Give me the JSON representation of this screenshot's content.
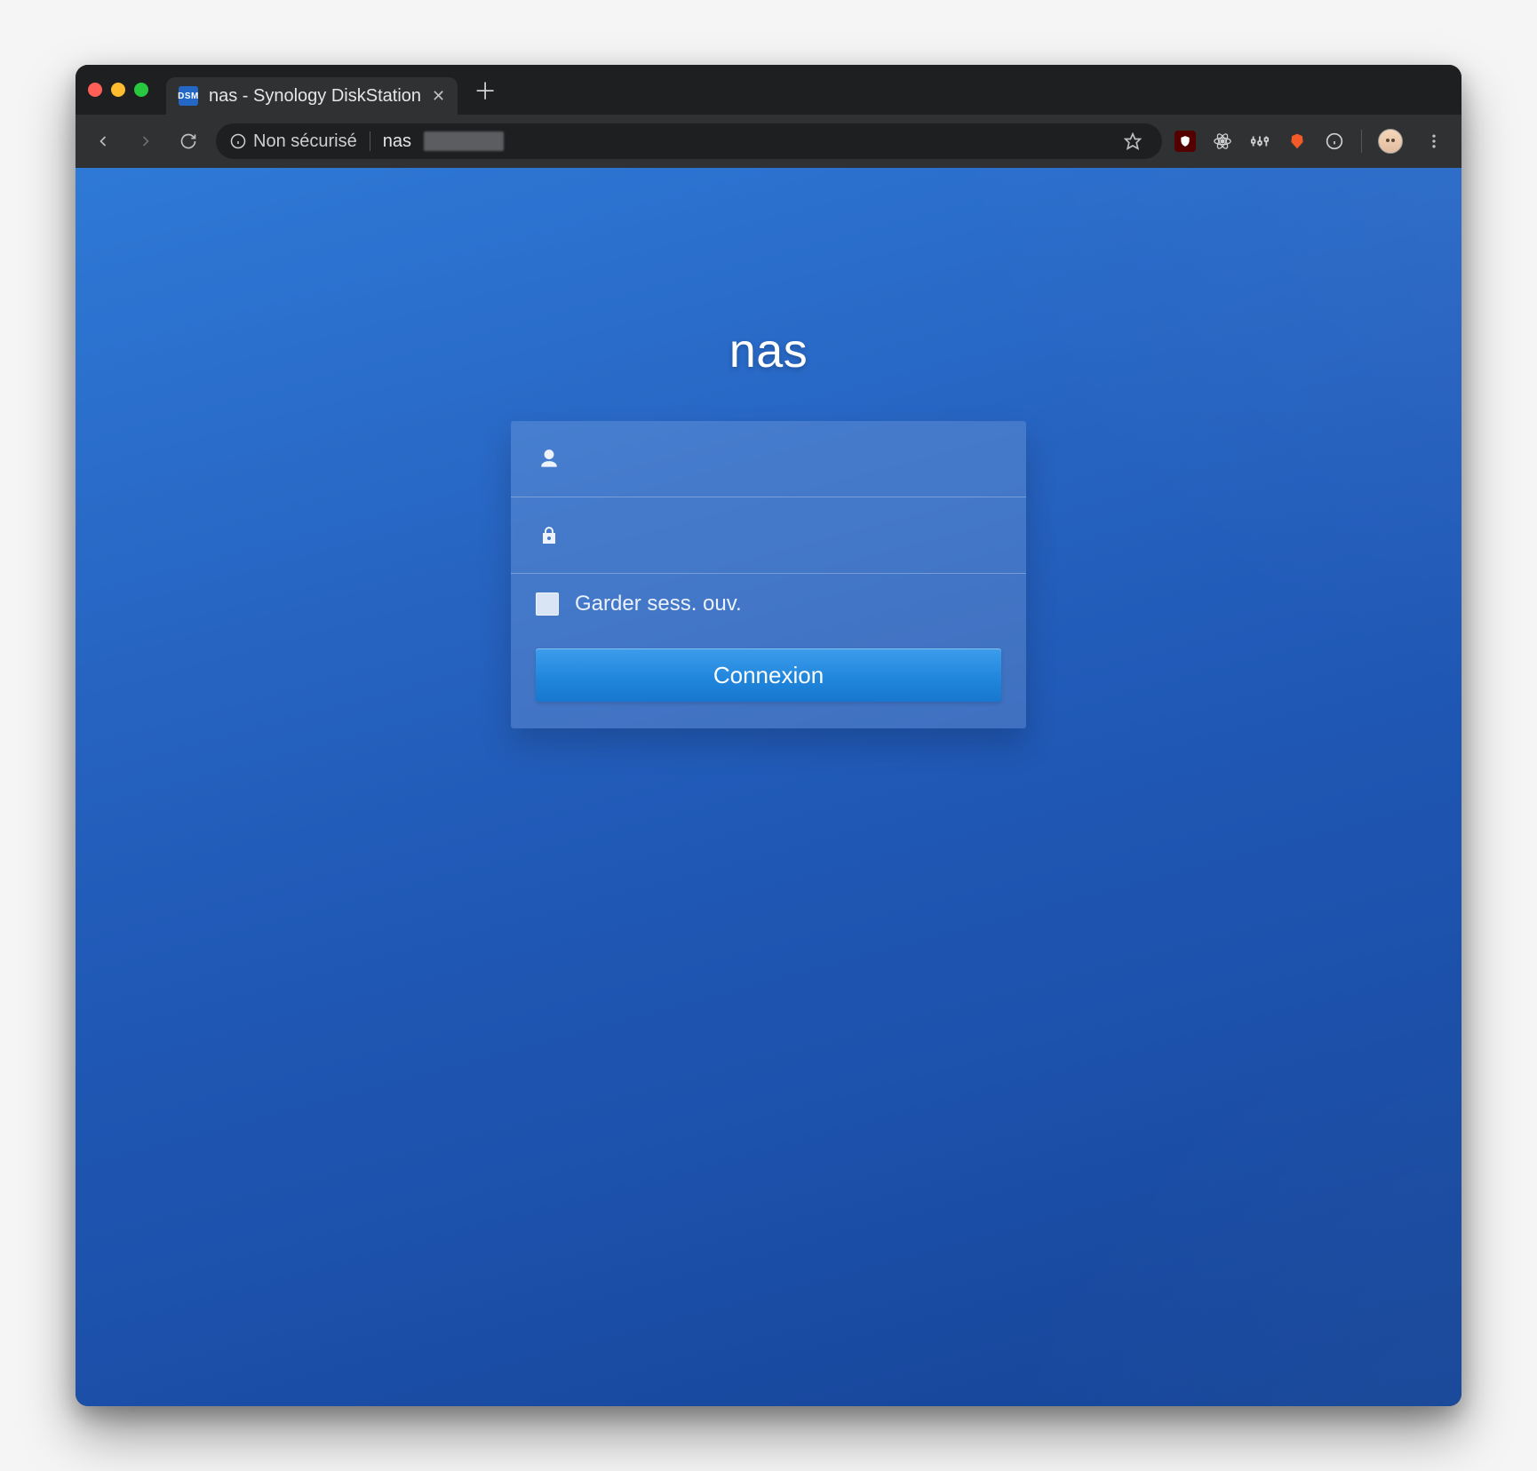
{
  "window": {
    "tab": {
      "title": "nas - Synology DiskStation",
      "favicon_label": "DSM"
    }
  },
  "toolbar": {
    "security_label": "Non sécurisé",
    "url_visible": "nas"
  },
  "login": {
    "hostname": "nas",
    "remember_label": "Garder sess. ouv.",
    "submit_label": "Connexion",
    "username_value": "",
    "password_value": ""
  }
}
